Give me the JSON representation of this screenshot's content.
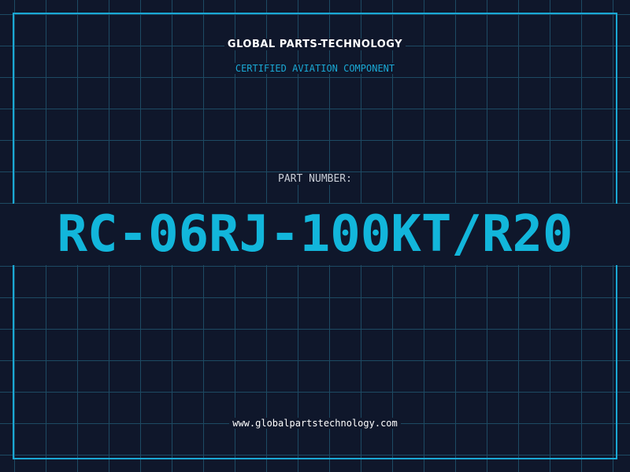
{
  "header": {
    "company": "GLOBAL PARTS-TECHNOLOGY",
    "subtitle": "CERTIFIED AVIATION COMPONENT"
  },
  "part": {
    "label": "PART NUMBER:",
    "number": "RC-06RJ-100KT/R20"
  },
  "footer": {
    "url": "www.globalpartstechnology.com"
  },
  "colors": {
    "background": "#0f172b",
    "grid": "#1d4a63",
    "accent": "#12b6db",
    "frame": "#1aa8d4"
  }
}
